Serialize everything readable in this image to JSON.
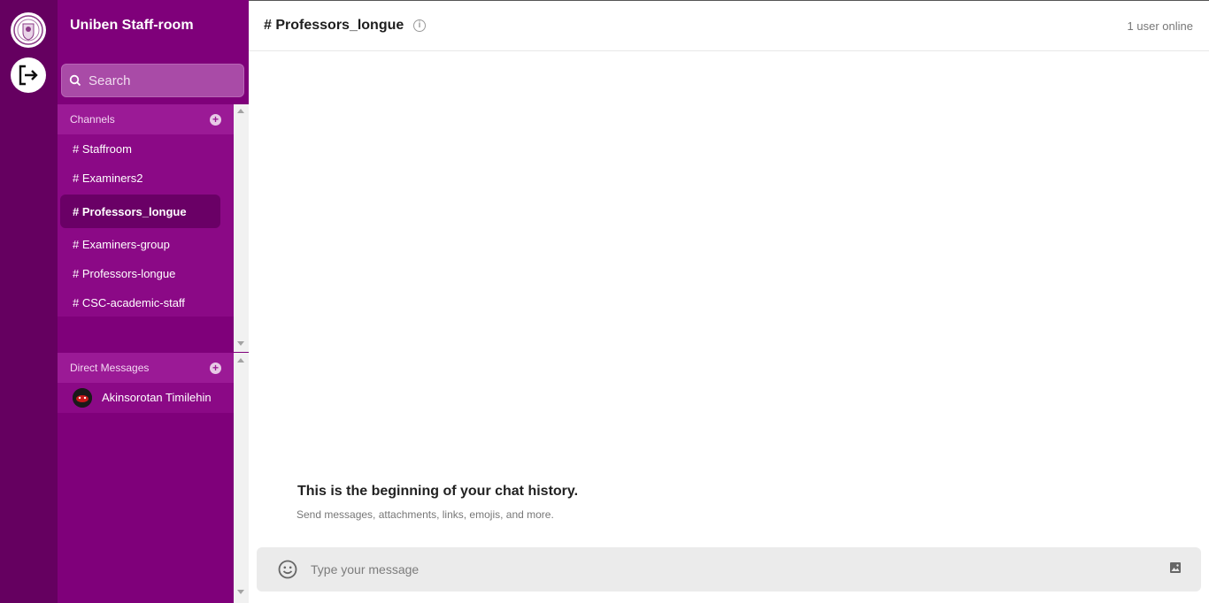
{
  "workspace": {
    "title": "Uniben Staff-room"
  },
  "search": {
    "placeholder": "Search"
  },
  "channels": {
    "heading": "Channels",
    "items": [
      {
        "label": "# Staffroom"
      },
      {
        "label": "# Examiners2"
      },
      {
        "label": "# Professors_longue"
      },
      {
        "label": "# Examiners-group"
      },
      {
        "label": "# Professors-longue"
      },
      {
        "label": "# CSC-academic-staff"
      }
    ]
  },
  "direct_messages": {
    "heading": "Direct Messages",
    "items": [
      {
        "label": "Akinsorotan Timilehin"
      }
    ]
  },
  "header": {
    "channel_title": "# Professors_longue",
    "online": "1 user online"
  },
  "chat": {
    "history_title": "This is the beginning of your chat history.",
    "history_subtitle": "Send messages, attachments, links, emojis, and more."
  },
  "composer": {
    "placeholder": "Type your message"
  },
  "colors": {
    "rail": "#650060",
    "sidebar": "#7f007a",
    "active_channel": "#6a0066"
  }
}
